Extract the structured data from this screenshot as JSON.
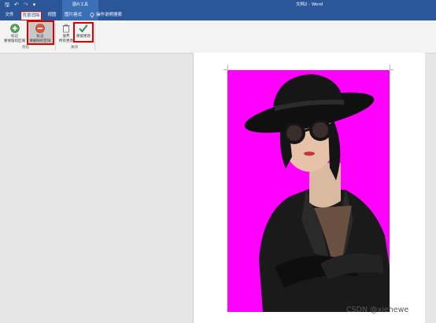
{
  "titlebar": {
    "qat": {
      "save": "🖫",
      "undo": "↶",
      "redo": "↷",
      "more": "▾"
    },
    "context_group": "图片工具",
    "doc_title": "文档2 - Word"
  },
  "tabs": [
    "文件",
    "背景消除",
    "视图",
    "图片格式"
  ],
  "tell_me": "操作说明搜索",
  "ribbon": {
    "buttons": [
      {
        "label": "标记\n要保留的区域",
        "icon": "add-circle-icon"
      },
      {
        "label": "标记\n要删除的区域",
        "icon": "minus-circle-icon"
      },
      {
        "label": "放弃\n所有更改",
        "icon": "trash-icon"
      },
      {
        "label": "保留更改",
        "icon": "check-icon"
      }
    ],
    "groups": [
      "优化",
      "关闭"
    ]
  },
  "watermark": "CSDN @xiehewe",
  "colors": {
    "title_blue": "#2b579a",
    "context_blue": "#3b6fb6",
    "highlight_red": "#e00000",
    "remove_area": "#ff00ff"
  }
}
